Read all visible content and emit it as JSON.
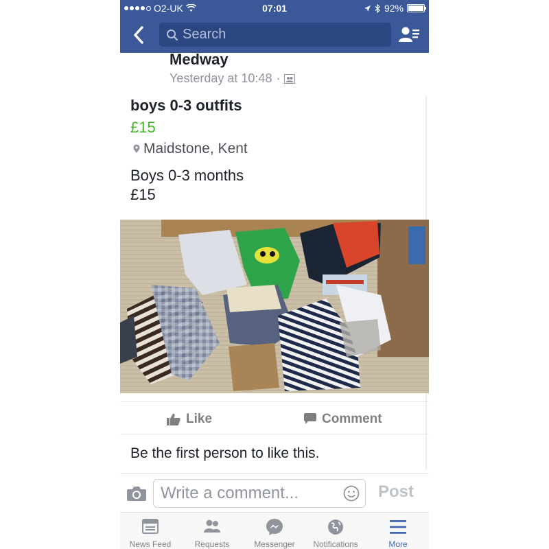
{
  "status_bar": {
    "carrier": "O2-UK",
    "time": "07:01",
    "battery": "92%"
  },
  "header": {
    "search_placeholder": "Search"
  },
  "post": {
    "seller_name": "Medway",
    "timestamp": "Yesterday at 10:48",
    "separator": "·"
  },
  "listing": {
    "title": "boys 0-3 outfits",
    "price": "£15",
    "location": "Maidstone, Kent",
    "description_line1": "Boys 0-3 months",
    "description_line2": "£15"
  },
  "actions": {
    "like": "Like",
    "comment": "Comment"
  },
  "likes_summary": "Be the first person to like this.",
  "comment_bar": {
    "placeholder": "Write a comment...",
    "post": "Post"
  },
  "tab_bar": {
    "items": [
      {
        "label": "News Feed"
      },
      {
        "label": "Requests"
      },
      {
        "label": "Messenger"
      },
      {
        "label": "Notifications"
      },
      {
        "label": "More"
      }
    ]
  },
  "colors": {
    "header_bg": "#3b5998",
    "price_green": "#42b72a",
    "active_tab": "#4267b2"
  }
}
